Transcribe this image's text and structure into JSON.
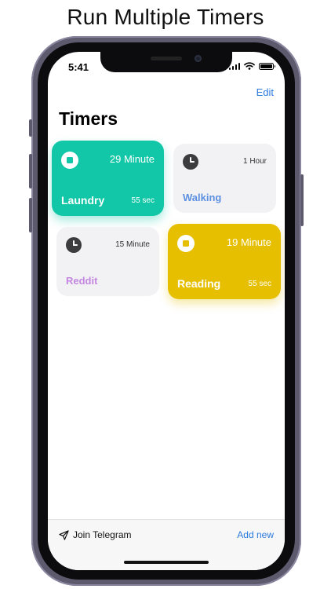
{
  "caption": "Run Multiple Timers",
  "status_bar": {
    "time": "5:41"
  },
  "nav": {
    "edit_label": "Edit"
  },
  "page": {
    "title": "Timers"
  },
  "timers": [
    {
      "name": "Laundry",
      "duration": "29 Minute",
      "elapsed": "55 sec",
      "state": "running",
      "color": "#12c7a7",
      "icon": "stop-icon"
    },
    {
      "name": "Walking",
      "duration": "1 Hour",
      "state": "idle",
      "color": "#5b8fe0",
      "icon": "clock-icon"
    },
    {
      "name": "Reddit",
      "duration": "15 Minute",
      "state": "idle",
      "color": "#c387e0",
      "icon": "clock-icon"
    },
    {
      "name": "Reading",
      "duration": "19 Minute",
      "elapsed": "55 sec",
      "state": "running",
      "color": "#e5bf00",
      "icon": "stop-icon"
    }
  ],
  "bottom_bar": {
    "telegram_label": "Join Telegram",
    "telegram_icon": "send-arrow-icon",
    "add_label": "Add new"
  },
  "colors": {
    "accent": "#2a7bde"
  }
}
